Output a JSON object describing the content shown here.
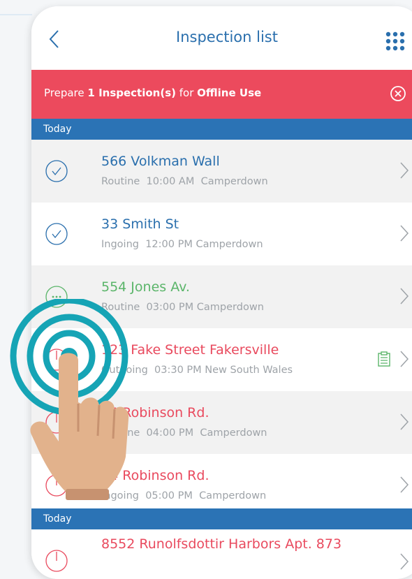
{
  "header": {
    "title": "Inspection list"
  },
  "banner": {
    "prefix": "Prepare ",
    "count_text": "1 Inspection(s)",
    "middle": " for ",
    "mode": "Offline Use"
  },
  "sections": [
    {
      "label": "Today"
    },
    {
      "label": "Today"
    }
  ],
  "inspections": [
    {
      "address": "566 Volkman Wall",
      "type": "Routine",
      "time": "10:00 AM",
      "suburb": "Camperdown",
      "status": "completed"
    },
    {
      "address": "33 Smith St",
      "type": "Ingoing",
      "time": "12:00 PM",
      "suburb": "Camperdown",
      "status": "completed"
    },
    {
      "address": "554 Jones Av.",
      "type": "Routine",
      "time": "03:00 PM",
      "suburb": "Camperdown",
      "status": "in-progress"
    },
    {
      "address": "123 Fake Street Fakersville",
      "type": "Outgoing",
      "time": "03:30 PM",
      "suburb": "New South Wales",
      "status": "pending",
      "has_note": true
    },
    {
      "address": "24 Robinson Rd.",
      "type": "Routine",
      "time": "04:00 PM",
      "suburb": "Camperdown",
      "status": "pending"
    },
    {
      "address": "24 Robinson Rd.",
      "type": "Ingoing",
      "time": "05:00 PM",
      "suburb": "Camperdown",
      "status": "pending"
    },
    {
      "address": "8552 Runolfsdottir Harbors Apt. 873",
      "status": "pending"
    }
  ],
  "colors": {
    "accent": "#2a6fad",
    "banner": "#ec4a5d",
    "section": "#2b73b5",
    "green": "#5bb56a",
    "red": "#e94a5e"
  }
}
